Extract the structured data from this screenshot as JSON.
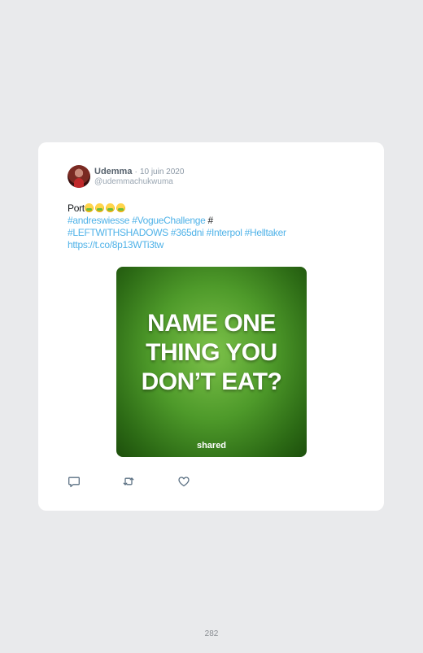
{
  "tweet": {
    "author_name": "Udemma",
    "separator": "·",
    "date": "10 juin 2020",
    "handle": "@udemmachukwuma",
    "text_start": "Port",
    "emoji_count": 4,
    "emoji_icon": "nauseated-face-emoji",
    "hashtag1": "#andreswiesse",
    "hashtag2": "#VogueChallenge",
    "hash_symbol": "#",
    "hashtag3": "#LEFTWITHSHADOWS",
    "hashtag4": "#365dni",
    "hashtag5": "#Interpol",
    "hashtag6": "#Helltaker",
    "link": "https://t.co/8p13WTi3tw",
    "media": {
      "headline_line1": "NAME ONE",
      "headline_line2": "THING YOU",
      "headline_line3": "DON’T EAT?",
      "brand": "shared"
    },
    "actions": [
      {
        "icon": "reply-icon"
      },
      {
        "icon": "retweet-icon"
      },
      {
        "icon": "like-icon"
      }
    ]
  },
  "page": {
    "number": "282"
  },
  "colors": {
    "background": "#e9eaec",
    "card": "#ffffff",
    "link": "#4fb2e8",
    "meta": "#8b98a5",
    "media_green": "#4e9a2a"
  }
}
